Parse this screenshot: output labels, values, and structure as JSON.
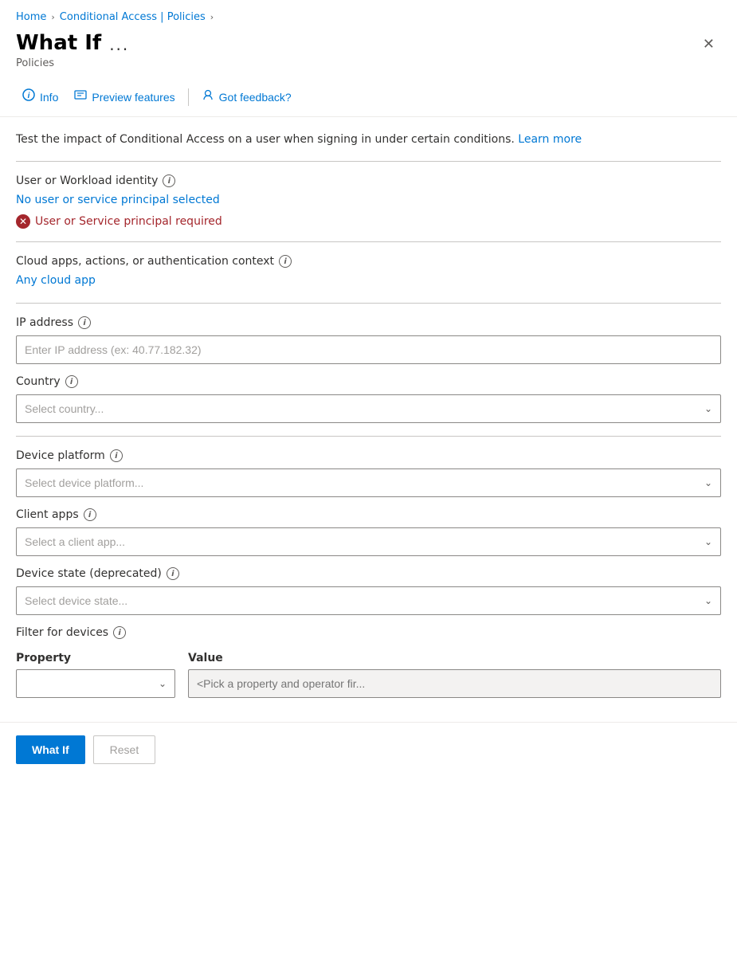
{
  "breadcrumb": {
    "home": "Home",
    "conditional_access": "Conditional Access | Policies"
  },
  "header": {
    "title": "What If",
    "more_options": "...",
    "subtitle": "Policies"
  },
  "toolbar": {
    "info_label": "Info",
    "preview_label": "Preview features",
    "feedback_label": "Got feedback?"
  },
  "description": {
    "text": "Test the impact of Conditional Access on a user when signing in under certain conditions.",
    "learn_more": "Learn more"
  },
  "user_identity": {
    "label": "User or Workload identity",
    "selected_text": "No user or service principal selected",
    "error_text": "User or Service principal required"
  },
  "cloud_apps": {
    "label": "Cloud apps, actions, or authentication context",
    "value": "Any cloud app"
  },
  "ip_address": {
    "label": "IP address",
    "placeholder": "Enter IP address (ex: 40.77.182.32)"
  },
  "country": {
    "label": "Country",
    "placeholder": "Select country..."
  },
  "device_platform": {
    "label": "Device platform",
    "placeholder": "Select device platform..."
  },
  "client_apps": {
    "label": "Client apps",
    "placeholder": "Select a client app..."
  },
  "device_state": {
    "label": "Device state (deprecated)",
    "placeholder": "Select device state..."
  },
  "filter_devices": {
    "label": "Filter for devices",
    "property_col": "Property",
    "value_col": "Value",
    "value_placeholder": "<Pick a property and operator fir..."
  },
  "actions": {
    "what_if": "What If",
    "reset": "Reset"
  }
}
